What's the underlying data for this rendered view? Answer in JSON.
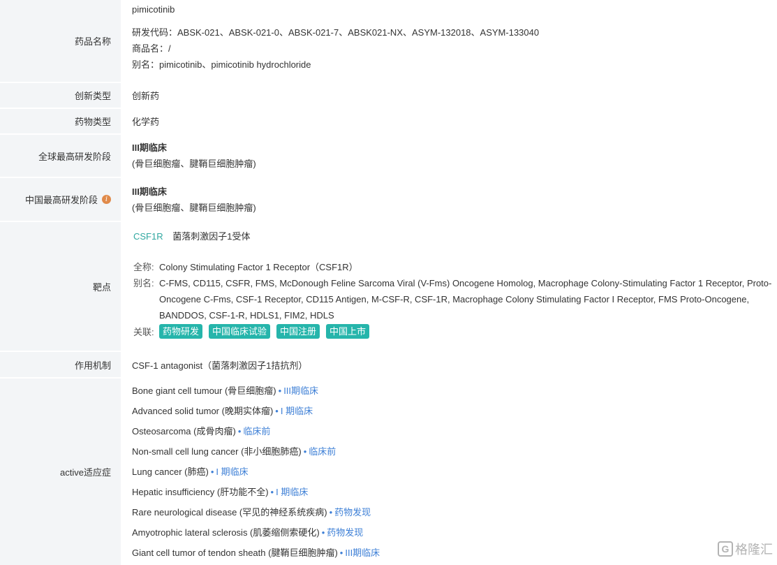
{
  "drug_name": {
    "label": "药品名称",
    "name": "pimicotinib",
    "codes": "研发代码：ABSK-021、ABSK-021-0、ABSK-021-7、ABSK021-NX、ASYM-132018、ASYM-133040",
    "trade_name": "商品名：/",
    "alias": "别名：pimicotinib、pimicotinib hydrochloride"
  },
  "innovation": {
    "label": "创新类型",
    "value": "创新药"
  },
  "drug_type": {
    "label": "药物类型",
    "value": "化学药"
  },
  "global_stage": {
    "label": "全球最高研发阶段",
    "stage": "III期临床",
    "note": "(骨巨细胞瘤、腱鞘巨细胞肿瘤)"
  },
  "china_stage": {
    "label": "中国最高研发阶段",
    "info_icon": "i",
    "stage": "III期临床",
    "note": "(骨巨细胞瘤、腱鞘巨细胞肿瘤)"
  },
  "target": {
    "label": "靶点",
    "symbol": "CSF1R",
    "name_cn": "菌落刺激因子1受体",
    "full_name_key": "全称:",
    "full_name": "Colony Stimulating Factor 1 Receptor（CSF1R）",
    "alias_key": "别名:",
    "aliases": "C-FMS, CD115, CSFR, FMS, McDonough Feline Sarcoma Viral (V-Fms) Oncogene Homolog, Macrophage Colony-Stimulating Factor 1 Receptor, Proto-Oncogene C-Fms, CSF-1 Receptor, CD115 Antigen, M-CSF-R, CSF-1R, Macrophage Colony Stimulating Factor I Receptor, FMS Proto-Oncogene, BANDDOS, CSF-1-R, HDLS1, FIM2, HDLS",
    "related_key": "关联:",
    "tags": [
      "药物研发",
      "中国临床试验",
      "中国注册",
      "中国上市"
    ]
  },
  "mechanism": {
    "label": "作用机制",
    "value": "CSF-1 antagonist（菌落刺激因子1拮抗剂）"
  },
  "indications": {
    "label": "active适应症",
    "items": [
      {
        "name": "Bone giant cell tumour (骨巨细胞瘤)",
        "stage": "III期临床"
      },
      {
        "name": "Advanced solid tumor (晚期实体瘤)",
        "stage": "I 期临床"
      },
      {
        "name": "Osteosarcoma (成骨肉瘤)",
        "stage": "临床前"
      },
      {
        "name": "Non-small cell lung cancer (非小细胞肺癌)",
        "stage": "临床前"
      },
      {
        "name": "Lung cancer (肺癌)",
        "stage": "I 期临床"
      },
      {
        "name": "Hepatic insufficiency (肝功能不全)",
        "stage": "I 期临床"
      },
      {
        "name": "Rare neurological disease (罕见的神经系统疾病)",
        "stage": "药物发现"
      },
      {
        "name": "Amyotrophic lateral sclerosis (肌萎缩侧索硬化)",
        "stage": "药物发现"
      },
      {
        "name": "Giant cell tumor of tendon sheath (腱鞘巨细胞肿瘤)",
        "stage": "III期临床"
      }
    ]
  },
  "watermark": {
    "logo": "G",
    "text": "格隆汇"
  }
}
